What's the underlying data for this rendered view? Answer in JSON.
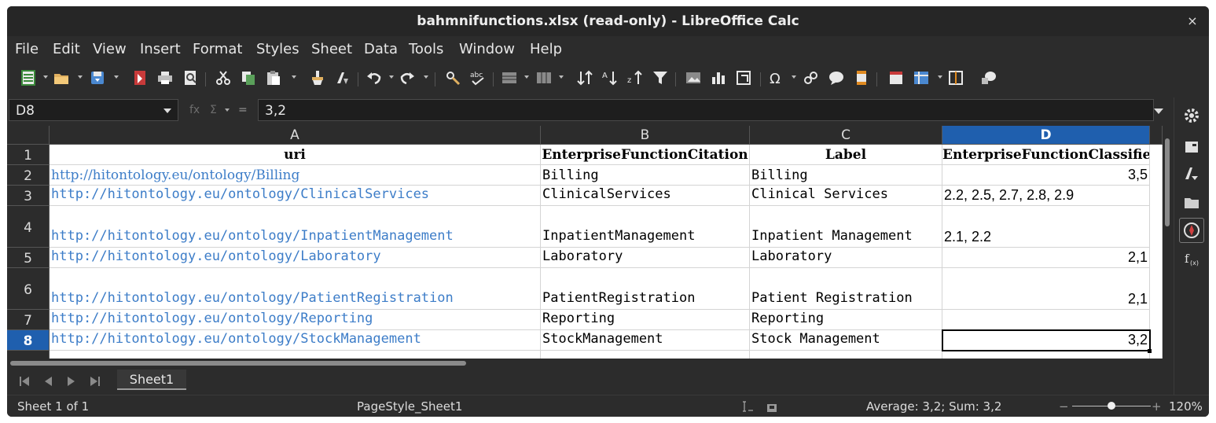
{
  "window": {
    "title": "bahmnifunctions.xlsx (read-only) - LibreOffice Calc",
    "close_glyph": "×"
  },
  "menu": [
    "File",
    "Edit",
    "View",
    "Insert",
    "Format",
    "Styles",
    "Sheet",
    "Data",
    "Tools",
    "Window",
    "Help"
  ],
  "formula_bar": {
    "cell_ref": "D8",
    "fx_glyph": "fx",
    "sum_glyph": "Σ",
    "equals_glyph": "=",
    "value": "3,2"
  },
  "columns": [
    "A",
    "B",
    "C",
    "D"
  ],
  "selected_column": "D",
  "header_row": {
    "row": "1",
    "cells": [
      "uri",
      "EnterpriseFunctionCitation",
      "Label",
      "EnterpriseFunctionClassified"
    ]
  },
  "rows": [
    {
      "row": "2",
      "uri": "http://hitontology.eu/ontology/Billing",
      "citation": "Billing",
      "label": "Billing",
      "classified": "3,5"
    },
    {
      "row": "3",
      "uri": "http://hitontology.eu/ontology/ClinicalServices",
      "citation": "ClinicalServices",
      "label": "Clinical Services",
      "classified": "2.2, 2.5, 2.7, 2.8, 2.9"
    },
    {
      "row": "4",
      "uri": "http://hitontology.eu/ontology/InpatientManagement",
      "citation": "InpatientManagement",
      "label": "Inpatient Management",
      "classified": "2.1, 2.2"
    },
    {
      "row": "5",
      "uri": "http://hitontology.eu/ontology/Laboratory",
      "citation": "Laboratory",
      "label": "Laboratory",
      "classified": "2,1"
    },
    {
      "row": "6",
      "uri": "http://hitontology.eu/ontology/PatientRegistration",
      "citation": "PatientRegistration",
      "label": "Patient Registration",
      "classified": "2,1"
    },
    {
      "row": "7",
      "uri": "http://hitontology.eu/ontology/Reporting",
      "citation": "Reporting",
      "label": "Reporting",
      "classified": ""
    },
    {
      "row": "8",
      "uri": "http://hitontology.eu/ontology/StockManagement",
      "citation": "StockManagement",
      "label": "Stock Management",
      "classified": "3,2"
    }
  ],
  "sheet_tabs": [
    "Sheet1"
  ],
  "status": {
    "sheet_position": "Sheet 1 of 1",
    "page_style": "PageStyle_Sheet1",
    "summary": "Average: 3,2; Sum: 3,2",
    "zoom_minus": "−",
    "zoom_plus": "+",
    "zoom": "120%",
    "zoom_level_fraction": 0.5
  },
  "toolbar_icons": [
    "new-icon",
    "open-icon",
    "save-icon",
    "export-pdf-icon",
    "print-icon",
    "print-preview-icon",
    "cut-icon",
    "copy-icon",
    "paste-icon",
    "clone-formatting-icon",
    "clear-formatting-icon",
    "undo-icon",
    "redo-icon",
    "find-replace-icon",
    "spelling-icon",
    "row-icon",
    "column-icon",
    "sort-icon",
    "sort-ascending-icon",
    "sort-descending-icon",
    "autofilter-icon",
    "image-icon",
    "chart-icon",
    "pivot-table-icon",
    "special-character-icon",
    "hyperlink-icon",
    "comment-icon",
    "headers-footers-icon",
    "define-print-area-icon",
    "freeze-rows-columns-icon",
    "split-window-icon",
    "show-draw-functions-icon"
  ],
  "sidebar_icons": [
    "properties-icon",
    "page-icon",
    "styles-icon",
    "gallery-icon",
    "navigator-icon",
    "functions-icon"
  ]
}
